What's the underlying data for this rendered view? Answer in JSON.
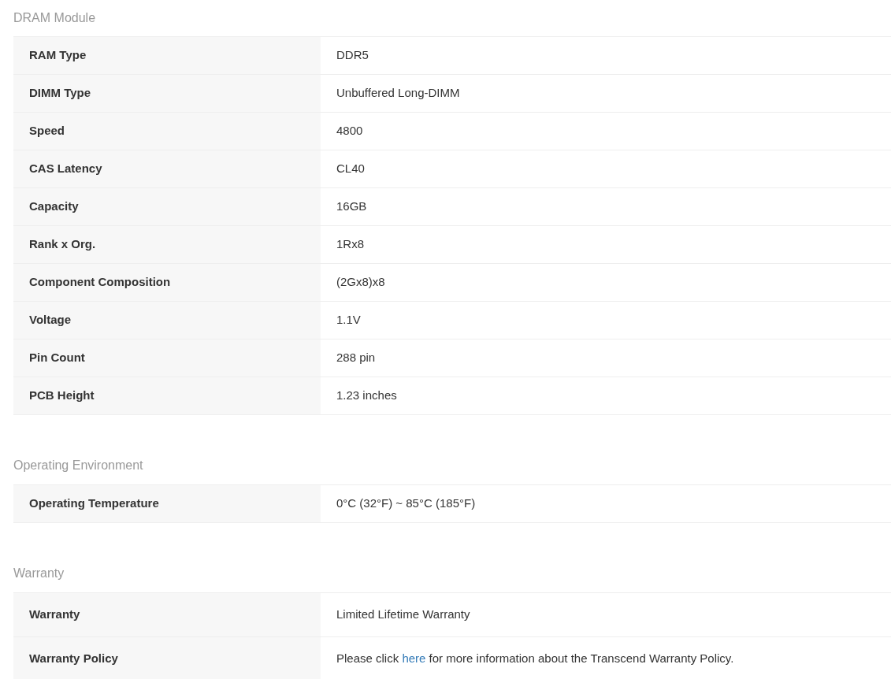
{
  "sections": [
    {
      "title": "DRAM Module",
      "rows": [
        {
          "label": "RAM Type",
          "kind": "text",
          "value": "DDR5"
        },
        {
          "label": "DIMM Type",
          "kind": "text",
          "value": "Unbuffered Long-DIMM"
        },
        {
          "label": "Speed",
          "kind": "text",
          "value": "4800"
        },
        {
          "label": "CAS Latency",
          "kind": "text",
          "value": "CL40"
        },
        {
          "label": "Capacity",
          "kind": "text",
          "value": "16GB"
        },
        {
          "label": "Rank x Org.",
          "kind": "text",
          "value": "1Rx8"
        },
        {
          "label": "Component Composition",
          "kind": "text",
          "value": "(2Gx8)x8"
        },
        {
          "label": "Voltage",
          "kind": "text",
          "value": "1.1V"
        },
        {
          "label": "Pin Count",
          "kind": "text",
          "value": "288 pin"
        },
        {
          "label": "PCB Height",
          "kind": "text",
          "value": "1.23 inches"
        }
      ]
    },
    {
      "title": "Operating Environment",
      "rows": [
        {
          "label": "Operating Temperature",
          "kind": "text",
          "value": "0°C (32°F) ~ 85°C (185°F)"
        }
      ]
    },
    {
      "title": "Warranty",
      "rows": [
        {
          "label": "Warranty",
          "kind": "text",
          "value": "Limited Lifetime Warranty"
        },
        {
          "label": "Warranty Policy",
          "kind": "link",
          "before": "Please click",
          "link": "here",
          "after": "for more information about the Transcend Warranty Policy."
        }
      ]
    }
  ]
}
